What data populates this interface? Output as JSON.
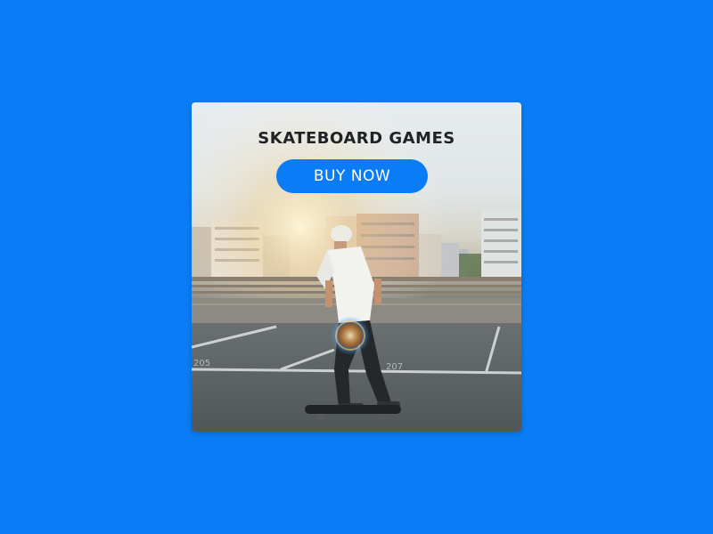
{
  "page": {
    "background_color": "#0a7cf5"
  },
  "ad": {
    "headline": "SKATEBOARD GAMES",
    "button_label": "BUY NOW",
    "button_color": "#0a7cf5",
    "photo_subject": "skateboarder-on-rooftop-parking",
    "parking_numbers": [
      "205",
      "207"
    ]
  }
}
